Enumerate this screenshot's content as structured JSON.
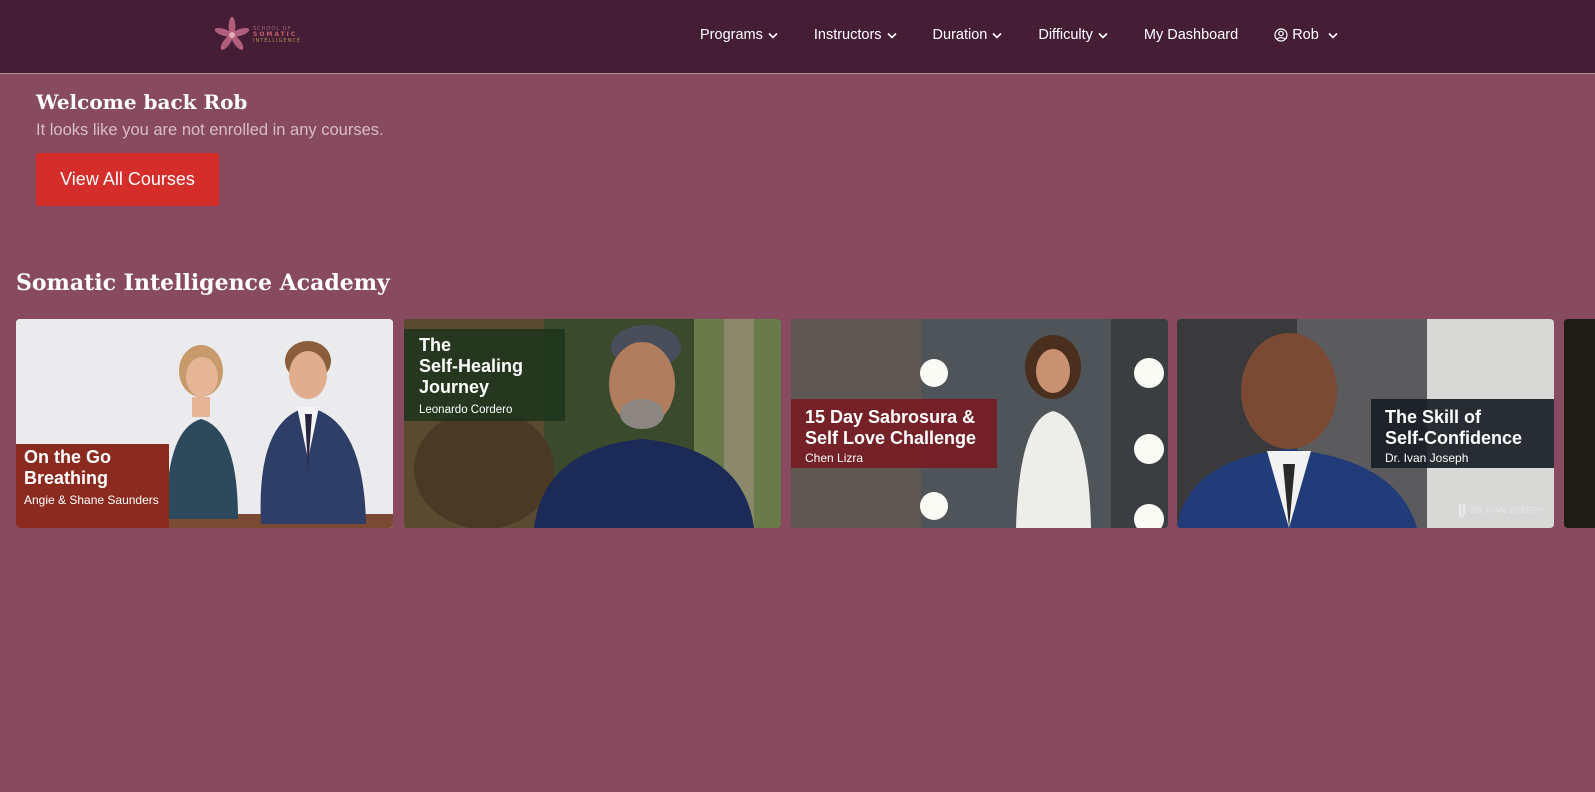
{
  "header": {
    "logo": {
      "line1": "SCHOOL OF",
      "line2": "SOMATIC",
      "line3": "INTELLIGENCE",
      "icon": "lotus-icon"
    },
    "nav": [
      {
        "label": "Programs",
        "icon": "chevron-down-icon"
      },
      {
        "label": "Instructors",
        "icon": "chevron-down-icon"
      },
      {
        "label": "Duration",
        "icon": "chevron-down-icon"
      },
      {
        "label": "Difficulty",
        "icon": "chevron-down-icon"
      },
      {
        "label": "My Dashboard"
      },
      {
        "label": "Rob",
        "icon": "user-circle-icon"
      }
    ]
  },
  "welcome": {
    "title": "Welcome back Rob",
    "subtitle": "It looks like you are not enrolled in any courses.",
    "button_label": "View All Courses"
  },
  "section": {
    "title": "Somatic Intelligence Academy",
    "courses": [
      {
        "title": "On the Go\nBreathing",
        "author": "Angie & Shane Saunders"
      },
      {
        "title": "The\nSelf-Healing\nJourney",
        "author": "Leonardo Cordero"
      },
      {
        "title": "15 Day Sabrosura &\nSelf Love Challenge",
        "author": "Chen Lizra"
      },
      {
        "title": "The Skill of\nSelf-Confidence",
        "author": "Dr. Ivan Joseph",
        "watermark": "DR.IVAN JOSEPH"
      }
    ]
  },
  "colors": {
    "page_bg": "#874a5e",
    "header_bg": "#451d35",
    "button_bg": "#d42d2a"
  }
}
